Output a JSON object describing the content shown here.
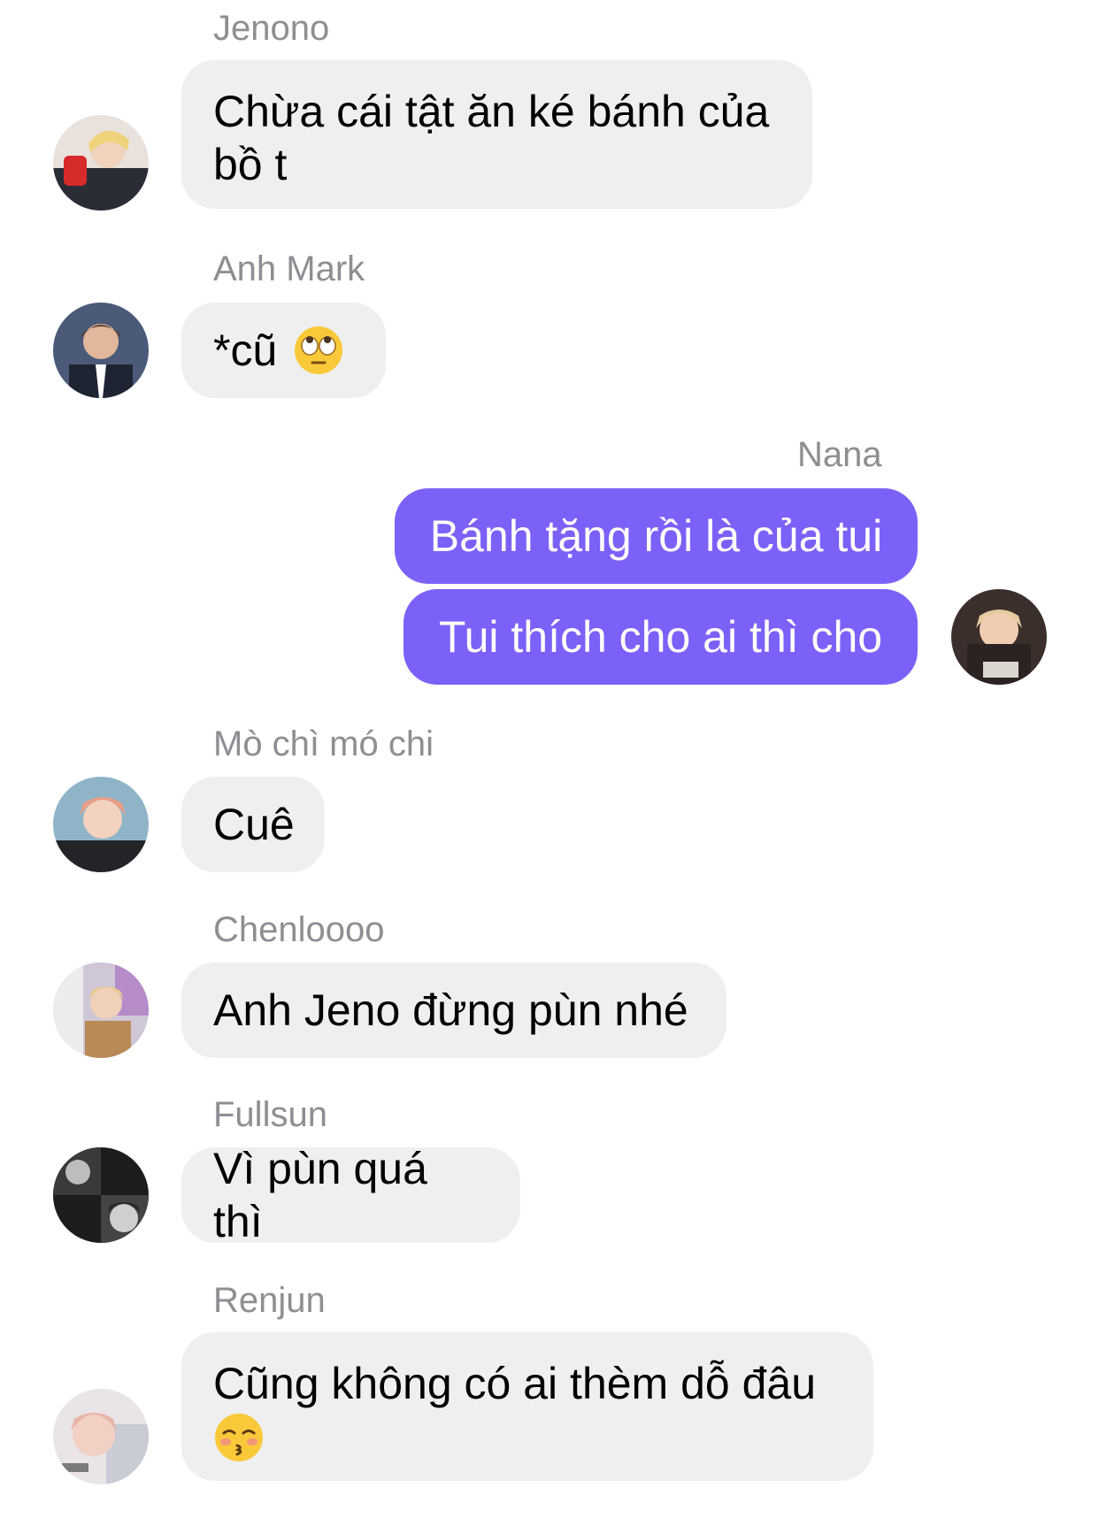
{
  "messages": [
    {
      "sender": "Jenono",
      "text_line1": "Chừa cái tật ăn ké bánh của",
      "text_line2": "bồ t",
      "avatar": "jenono-avatar"
    },
    {
      "sender": "Anh Mark",
      "text": "*cũ",
      "emoji": "face-with-rolling-eyes-icon",
      "avatar": "mark-avatar"
    },
    {
      "sender": "Nana",
      "text_1": "Bánh tặng rồi là của tui",
      "text_2": "Tui thích cho ai thì cho",
      "avatar": "nana-avatar"
    },
    {
      "sender": "Mò chì mó chi",
      "text": "Cuê",
      "avatar": "mochi-avatar"
    },
    {
      "sender": "Chenloooo",
      "text": "Anh Jeno đừng pùn nhé",
      "avatar": "chenle-avatar"
    },
    {
      "sender": "Fullsun",
      "text": "Vì pùn quá thì",
      "avatar": "fullsun-avatar"
    },
    {
      "sender": "Renjun",
      "text": "Cũng không có ai thèm dỗ đâu",
      "emoji": "kissing-face-icon",
      "avatar": "renjun-avatar"
    }
  ],
  "colors": {
    "incoming_bubble": "#efefef",
    "outgoing_bubble": "#7b61f8",
    "sender_name": "#8e8e93"
  }
}
